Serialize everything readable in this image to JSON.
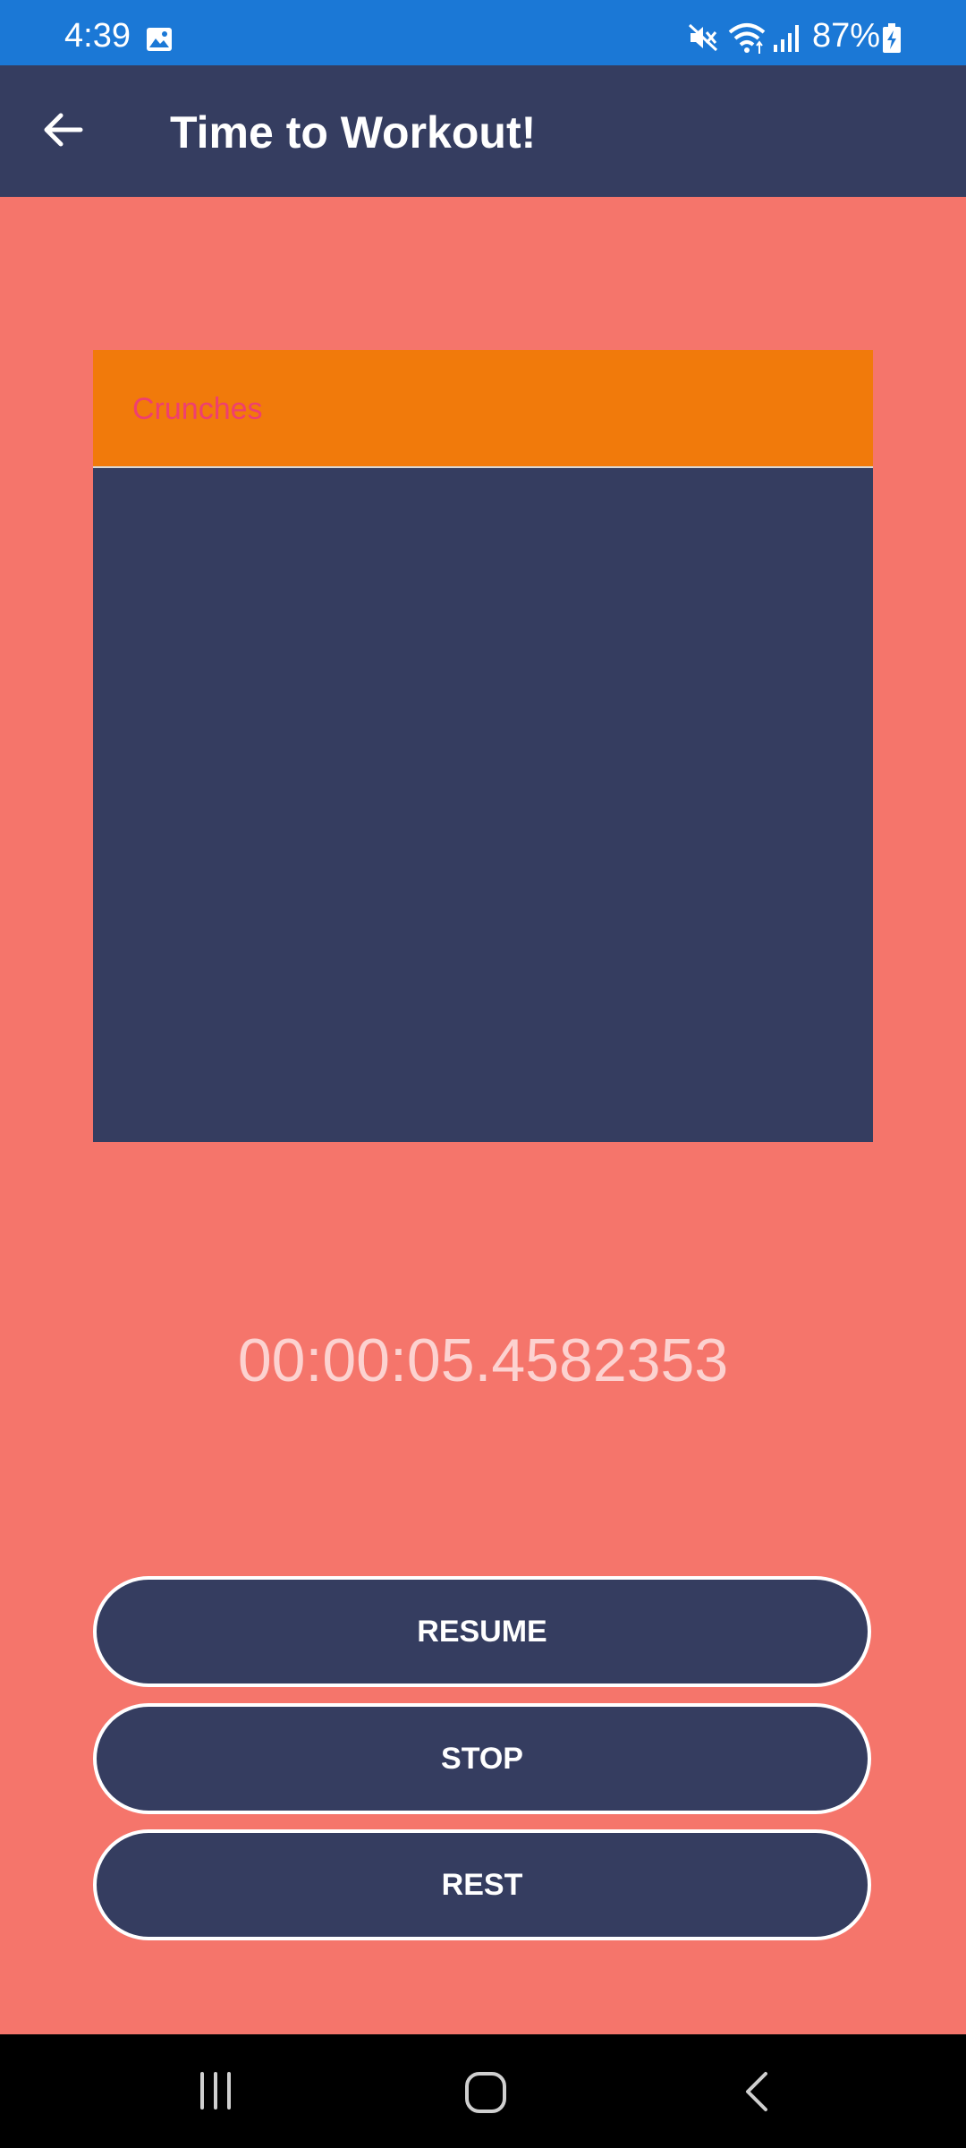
{
  "status_bar": {
    "time": "4:39",
    "battery": "87%",
    "icons": [
      "gallery-icon",
      "mute-icon",
      "wifi-icon",
      "signal-icon",
      "battery-charging-icon"
    ]
  },
  "app_bar": {
    "title": "Time to Workout!",
    "back_icon": "arrow-left-icon"
  },
  "exercise": {
    "name": "Crunches"
  },
  "timer": {
    "value": "00:00:05.4582353"
  },
  "buttons": {
    "resume": "RESUME",
    "stop": "STOP",
    "rest": "REST"
  },
  "nav_bar": {
    "icons": [
      "recent-apps-icon",
      "home-icon",
      "back-icon"
    ]
  },
  "colors": {
    "status_bar": "#1b78d6",
    "app_bar": "#353d60",
    "background": "#f5756b",
    "card_header": "#f17a0b",
    "exercise_name": "#ef3f70",
    "timer_text": "#fcd2d0"
  }
}
